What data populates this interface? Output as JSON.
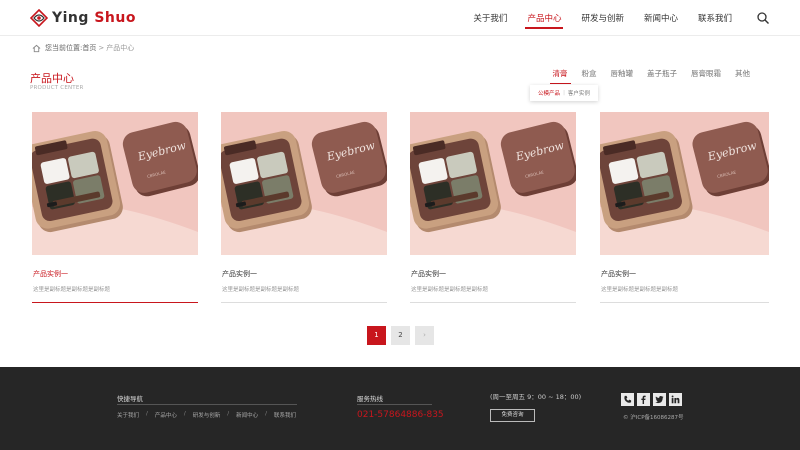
{
  "header": {
    "logo_prefix": "Ying ",
    "logo_suffix": "Shuo",
    "nav": [
      "关于我们",
      "产品中心",
      "研发与创新",
      "新闻中心",
      "联系我们"
    ],
    "nav_active_index": 1
  },
  "breadcrumb": {
    "prefix": "您当前位置:",
    "home": "首页",
    "separator": ">",
    "current": "产品中心"
  },
  "section": {
    "title": "产品中心",
    "subtitle": "PRODUCT CENTER"
  },
  "tabs": [
    "清膏",
    "粉盒",
    "唇釉罐",
    "盖子瓶子",
    "唇膏眼霜",
    "其他"
  ],
  "tab_active_index": 0,
  "subtabs": [
    "公模产品",
    "客户实例"
  ],
  "subtab_active_index": 0,
  "products": [
    {
      "name": "产品实例一",
      "desc": "这里是副标题是副标题是副标题"
    },
    {
      "name": "产品实例一",
      "desc": "这里是副标题是副标题是副标题"
    },
    {
      "name": "产品实例一",
      "desc": "这里是副标题是副标题是副标题"
    },
    {
      "name": "产品实例一",
      "desc": "这里是副标题是副标题是副标题"
    }
  ],
  "product_label_case": "Eyebrow",
  "product_label_brand": "CBROLAE",
  "pagination": {
    "pages": [
      "1",
      "2"
    ],
    "current": "1",
    "next": "›"
  },
  "footer": {
    "nav_title": "快捷导航",
    "links": [
      "关于我们",
      "产品中心",
      "研发与创新",
      "新闻中心",
      "联系我们"
    ],
    "link_separator": "/",
    "hotline_title": "服务热线",
    "hotline": "021-57864886-835",
    "hours": "(周一至周五 9：00 ~ 18：00)",
    "consult_button": "免费咨询",
    "social_icons": [
      "phone-icon",
      "facebook-icon",
      "twitter-icon",
      "linkedin-icon"
    ],
    "icp": "© 沪ICP备16086287号"
  },
  "colors": {
    "accent": "#c8161d",
    "footer_bg": "#262626",
    "card_bg": "#f1c6bf"
  }
}
